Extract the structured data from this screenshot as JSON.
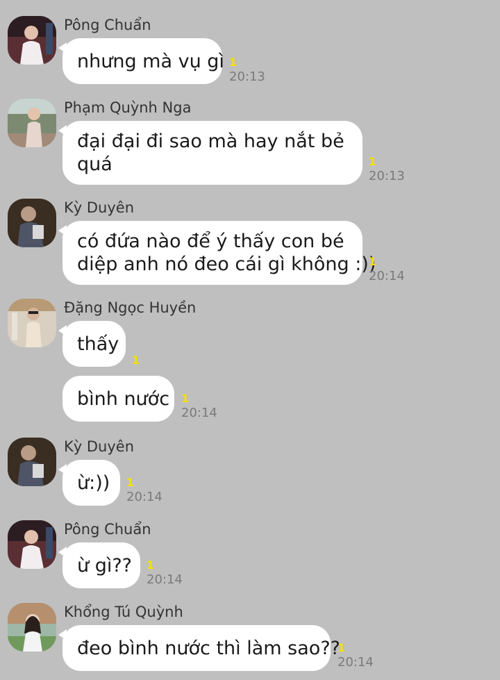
{
  "accent": {
    "unread_color": "#f2e200",
    "bubble_color": "#ffffff",
    "background": "#bfbfbf"
  },
  "messages": [
    {
      "sender": "Pông Chuẩn",
      "avatar": "avatar-pong-chuan",
      "bubbles": [
        {
          "lines": [
            "nhưng mà vụ gì"
          ],
          "unread": "1",
          "time": "20:13"
        }
      ]
    },
    {
      "sender": "Phạm Quỳnh Nga",
      "avatar": "avatar-pham-quynh-nga",
      "bubbles": [
        {
          "lines": [
            "đại đại đi sao mà hay nắt bẻ",
            "quá"
          ],
          "unread": "1",
          "time": "20:13"
        }
      ]
    },
    {
      "sender": "Kỳ Duyên",
      "avatar": "avatar-ky-duyen",
      "bubbles": [
        {
          "lines": [
            "có đứa nào để ý thấy con bé",
            "diệp anh nó đeo cái gì không :))"
          ],
          "unread": "1",
          "time": "20:14"
        }
      ]
    },
    {
      "sender": "Đặng Ngọc Huyền",
      "avatar": "avatar-dang-ngoc-huyen",
      "bubbles": [
        {
          "lines": [
            "thấy"
          ],
          "unread": "1",
          "time": ""
        },
        {
          "lines": [
            "bình nước"
          ],
          "unread": "1",
          "time": "20:14"
        }
      ]
    },
    {
      "sender": "Kỳ Duyên",
      "avatar": "avatar-ky-duyen",
      "bubbles": [
        {
          "lines": [
            "ừ:))"
          ],
          "unread": "1",
          "time": "20:14"
        }
      ]
    },
    {
      "sender": "Pông Chuẩn",
      "avatar": "avatar-pong-chuan",
      "bubbles": [
        {
          "lines": [
            "ừ gì??"
          ],
          "unread": "1",
          "time": "20:14"
        }
      ]
    },
    {
      "sender": "Khổng Tú Quỳnh",
      "avatar": "avatar-khong-tu-quynh",
      "bubbles": [
        {
          "lines": [
            "đeo bình nước thì làm sao??"
          ],
          "unread": "1",
          "time": "20:14"
        }
      ]
    }
  ]
}
